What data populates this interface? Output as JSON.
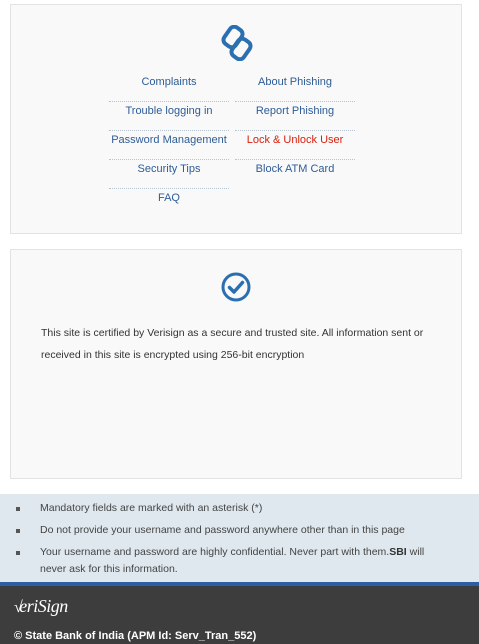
{
  "links": {
    "left": [
      {
        "label": "Complaints"
      },
      {
        "label": "Trouble logging in"
      },
      {
        "label": "Password Management"
      },
      {
        "label": "Security Tips"
      },
      {
        "label": "FAQ"
      }
    ],
    "right": [
      {
        "label": "About Phishing"
      },
      {
        "label": "Report Phishing"
      },
      {
        "label": "Lock & Unlock User"
      },
      {
        "label": "Block ATM Card"
      }
    ]
  },
  "certificate": {
    "text": "This site is certified by Verisign as a secure and trusted site. All information sent or received in this site is encrypted using 256-bit encryption"
  },
  "notes": {
    "items": [
      {
        "text": "Mandatory fields are marked with an asterisk (*)"
      },
      {
        "text": "Do not provide your username and password anywhere other than in this page"
      },
      {
        "text": "Your username and password are highly confidential. Never part with them.",
        "bold": "SBI",
        "tail": " will never ask for this information."
      }
    ]
  },
  "footer": {
    "logo_text": "eriSign",
    "logo_check": "√",
    "copyright": "© State Bank of India (APM Id: Serv_Tran_552)"
  },
  "colors": {
    "link": "#2e5c96",
    "link_alert": "#d9200f",
    "icon": "#2c6fb0",
    "footer_bg": "#3d3d3d",
    "footer_border": "#2c5ea3",
    "notes_bg": "#dfe8ee"
  },
  "icons": {
    "links_panel": "link-chain-icon",
    "cert_panel": "check-circle-icon"
  }
}
